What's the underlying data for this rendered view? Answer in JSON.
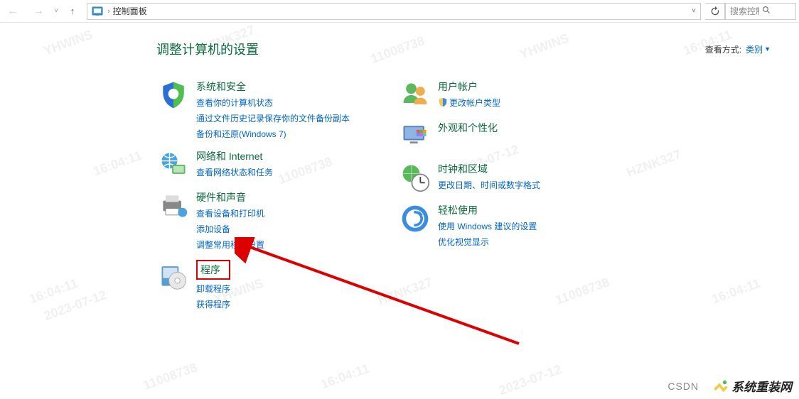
{
  "nav": {
    "breadcrumb": "控制面板"
  },
  "search": {
    "placeholder": "搜索控制..."
  },
  "header": {
    "title": "调整计算机的设置",
    "viewByLabel": "查看方式:",
    "viewByValue": "类别"
  },
  "left": [
    {
      "title": "系统和安全",
      "links": [
        "查看你的计算机状态",
        "通过文件历史记录保存你的文件备份副本",
        "备份和还原(Windows 7)"
      ]
    },
    {
      "title": "网络和 Internet",
      "links": [
        "查看网络状态和任务"
      ]
    },
    {
      "title": "硬件和声音",
      "links": [
        "查看设备和打印机",
        "添加设备",
        "调整常用移动设置"
      ]
    },
    {
      "title": "程序",
      "boxed": true,
      "links": [
        "卸载程序",
        "获得程序"
      ]
    }
  ],
  "right": [
    {
      "title": "用户帐户",
      "links": [
        "更改帐户类型"
      ],
      "shield": [
        true
      ]
    },
    {
      "title": "外观和个性化",
      "links": []
    },
    {
      "title": "时钟和区域",
      "links": [
        "更改日期、时间或数字格式"
      ]
    },
    {
      "title": "轻松使用",
      "links": [
        "使用 Windows 建议的设置",
        "优化视觉显示"
      ]
    }
  ],
  "footer": {
    "csdn": "CSDN",
    "brand": "系统重装网"
  },
  "watermarks": [
    "YHWINS",
    "HZNK327",
    "11008738",
    "2023-07-12",
    "16:04:11"
  ]
}
